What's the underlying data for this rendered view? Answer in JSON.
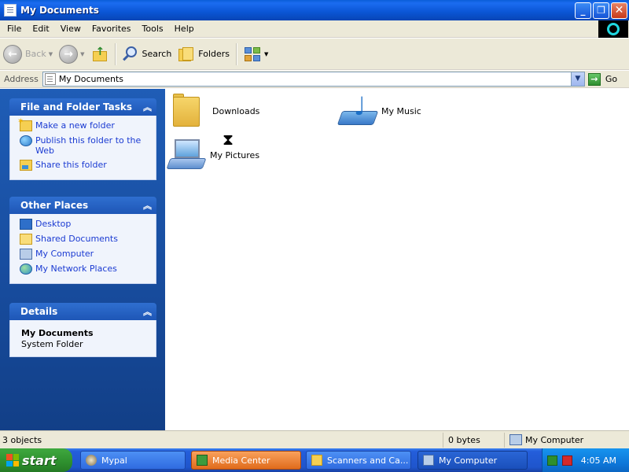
{
  "window": {
    "title": "My Documents",
    "controls": {
      "minimize": "_",
      "maximize": "❐",
      "close": "✕"
    }
  },
  "menu": [
    "File",
    "Edit",
    "View",
    "Favorites",
    "Tools",
    "Help"
  ],
  "toolbar": {
    "back_label": "Back",
    "search_label": "Search",
    "folders_label": "Folders"
  },
  "address": {
    "label": "Address",
    "value": "My Documents",
    "go_label": "Go"
  },
  "tasks": {
    "file_folder": {
      "title": "File and Folder Tasks",
      "items": [
        "Make a new folder",
        "Publish this folder to the Web",
        "Share this folder"
      ]
    },
    "other_places": {
      "title": "Other Places",
      "items": [
        "Desktop",
        "Shared Documents",
        "My Computer",
        "My Network Places"
      ]
    },
    "details": {
      "title": "Details",
      "name": "My Documents",
      "type": "System Folder"
    }
  },
  "items": [
    {
      "label": "Downloads",
      "icon": "folder-icon"
    },
    {
      "label": "My Music",
      "icon": "music-folder-icon"
    },
    {
      "label": "My Pictures",
      "icon": "pictures-folder-icon"
    }
  ],
  "status": {
    "count": "3 objects",
    "size": "0 bytes",
    "zone": "My Computer"
  },
  "taskbar": {
    "start_label": "start",
    "tasks": [
      "Mypal",
      "Media Center",
      "Scanners and Ca...",
      "My Computer"
    ],
    "clock": "4:05 AM"
  },
  "colors": {
    "titlebar": "#0a55d4",
    "taskpane": "#1f5db6",
    "link": "#1b3bd2",
    "start": "#2e8f2e",
    "media_center_active": "#e06b1c"
  }
}
